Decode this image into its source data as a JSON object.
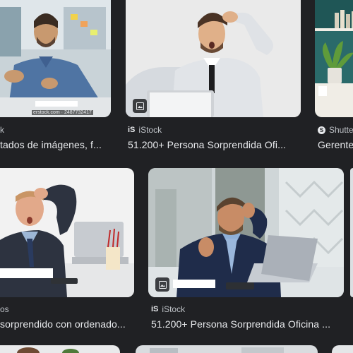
{
  "results": [
    {
      "source": "k",
      "title": "tados de imágenes, f...",
      "watermark": "erstock.com · 2487732417"
    },
    {
      "source": "iStock",
      "source_logo": "iS",
      "title": "51.200+ Persona Sorprendida Ofi..."
    },
    {
      "source": "Shutte",
      "title": "Gerente"
    },
    {
      "source": "os",
      "title": "sorprendido con ordenado..."
    },
    {
      "source": "iStock",
      "source_logo": "iS",
      "title": "51.200+ Persona Sorprendida Oficina ..."
    }
  ],
  "icons": {
    "image_badge": "image-icon",
    "shutterstock_logo": "shutterstock-logo-icon"
  },
  "colors": {
    "background": "#202124",
    "title_text": "#e8eaed",
    "source_text": "#bdc1c6"
  }
}
